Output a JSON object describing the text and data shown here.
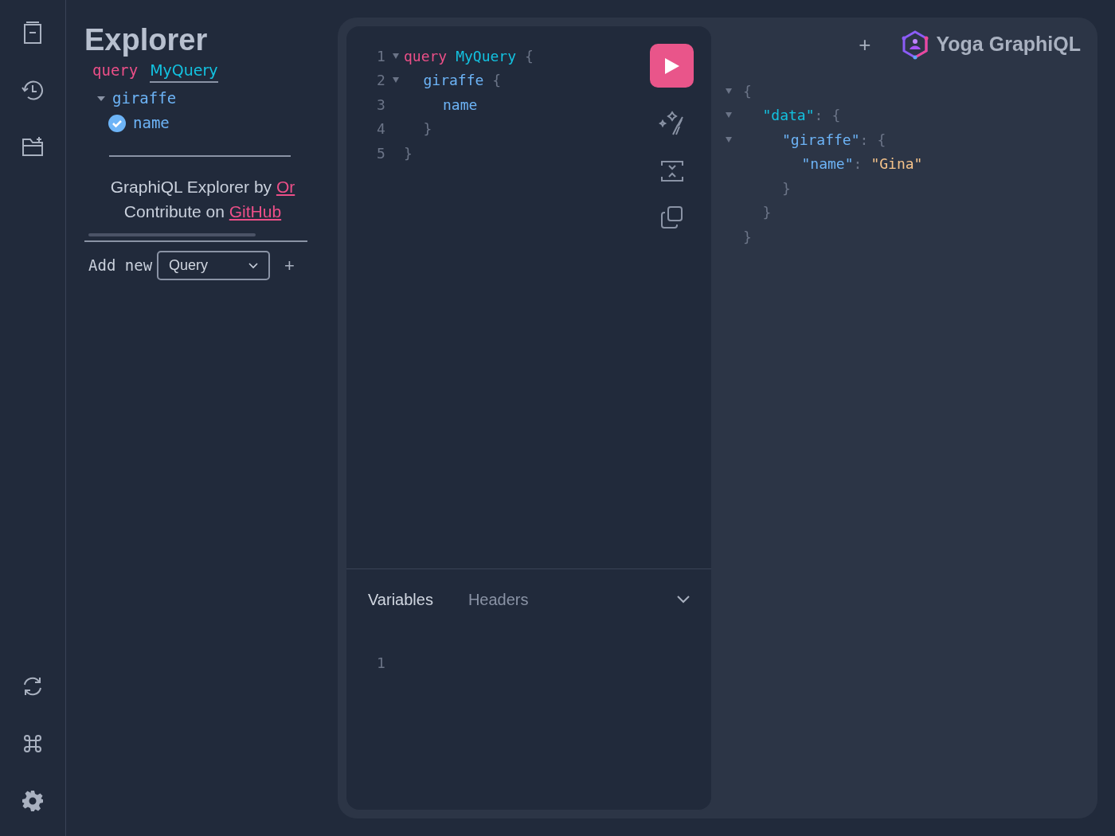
{
  "explorer": {
    "title": "Explorer",
    "operation": {
      "keyword": "query",
      "name": "MyQuery"
    },
    "fields": [
      {
        "name": "giraffe",
        "expanded": true,
        "children": [
          {
            "name": "name",
            "checked": true
          }
        ]
      }
    ],
    "credits": [
      {
        "text": "GraphiQL Explorer by ",
        "link": "Or"
      },
      {
        "text": "Contribute on ",
        "link": "GitHub"
      }
    ],
    "add_new": {
      "label": "Add new",
      "select": "Query",
      "button": "+"
    }
  },
  "editor": {
    "lines": [
      {
        "number": "1",
        "foldable": true,
        "tokens": [
          {
            "kind": "keyword",
            "text": "query"
          },
          {
            "kind": "def",
            "text": "MyQuery"
          },
          {
            "kind": "punct",
            "text": "{"
          }
        ],
        "children": [
          {
            "number": "2",
            "foldable": true,
            "tokens": [
              {
                "kind": "field",
                "text": "giraffe"
              },
              {
                "kind": "punct",
                "text": "{"
              }
            ],
            "children": [
              {
                "number": "3",
                "foldable": false,
                "tokens": [
                  {
                    "kind": "field",
                    "text": "name"
                  }
                ]
              }
            ]
          },
          {
            "number": "4",
            "foldable": false,
            "tokens": [
              {
                "kind": "punct",
                "text": "}"
              }
            ]
          }
        ]
      },
      {
        "number": "5",
        "foldable": false,
        "tokens": [
          {
            "kind": "punct",
            "text": "}"
          }
        ]
      }
    ],
    "tabs": [
      {
        "label": "Variables",
        "selected": true
      },
      {
        "label": "Headers",
        "selected": false
      }
    ],
    "variables_lines": [
      "1"
    ]
  },
  "results": {
    "add_button": "+",
    "brand": "Yoga GraphiQL",
    "lines": [
      {
        "foldable": true,
        "tokens": [
          {
            "kind": "punct",
            "text": "{"
          }
        ],
        "children": [
          {
            "foldable": true,
            "tokens": [
              {
                "kind": "key1",
                "text": "\"data\""
              },
              {
                "kind": "colon",
                "text": ":"
              },
              {
                "kind": "punct",
                "text": "{"
              }
            ],
            "children": [
              {
                "foldable": true,
                "tokens": [
                  {
                    "kind": "key",
                    "text": "\"giraffe\""
                  },
                  {
                    "kind": "colon",
                    "text": ":"
                  },
                  {
                    "kind": "punct",
                    "text": "{"
                  }
                ],
                "children": [
                  {
                    "foldable": false,
                    "tokens": [
                      {
                        "kind": "key",
                        "text": "\"name\""
                      },
                      {
                        "kind": "colon",
                        "text": ":"
                      },
                      {
                        "kind": "string",
                        "text": "\"Gina\""
                      }
                    ]
                  }
                ]
              },
              {
                "foldable": false,
                "tokens": [
                  {
                    "kind": "punct",
                    "text": "}"
                  }
                ]
              }
            ]
          },
          {
            "foldable": false,
            "tokens": [
              {
                "kind": "punct",
                "text": "}"
              }
            ]
          }
        ]
      },
      {
        "foldable": false,
        "tokens": [
          {
            "kind": "punct",
            "text": "}"
          }
        ]
      }
    ]
  }
}
